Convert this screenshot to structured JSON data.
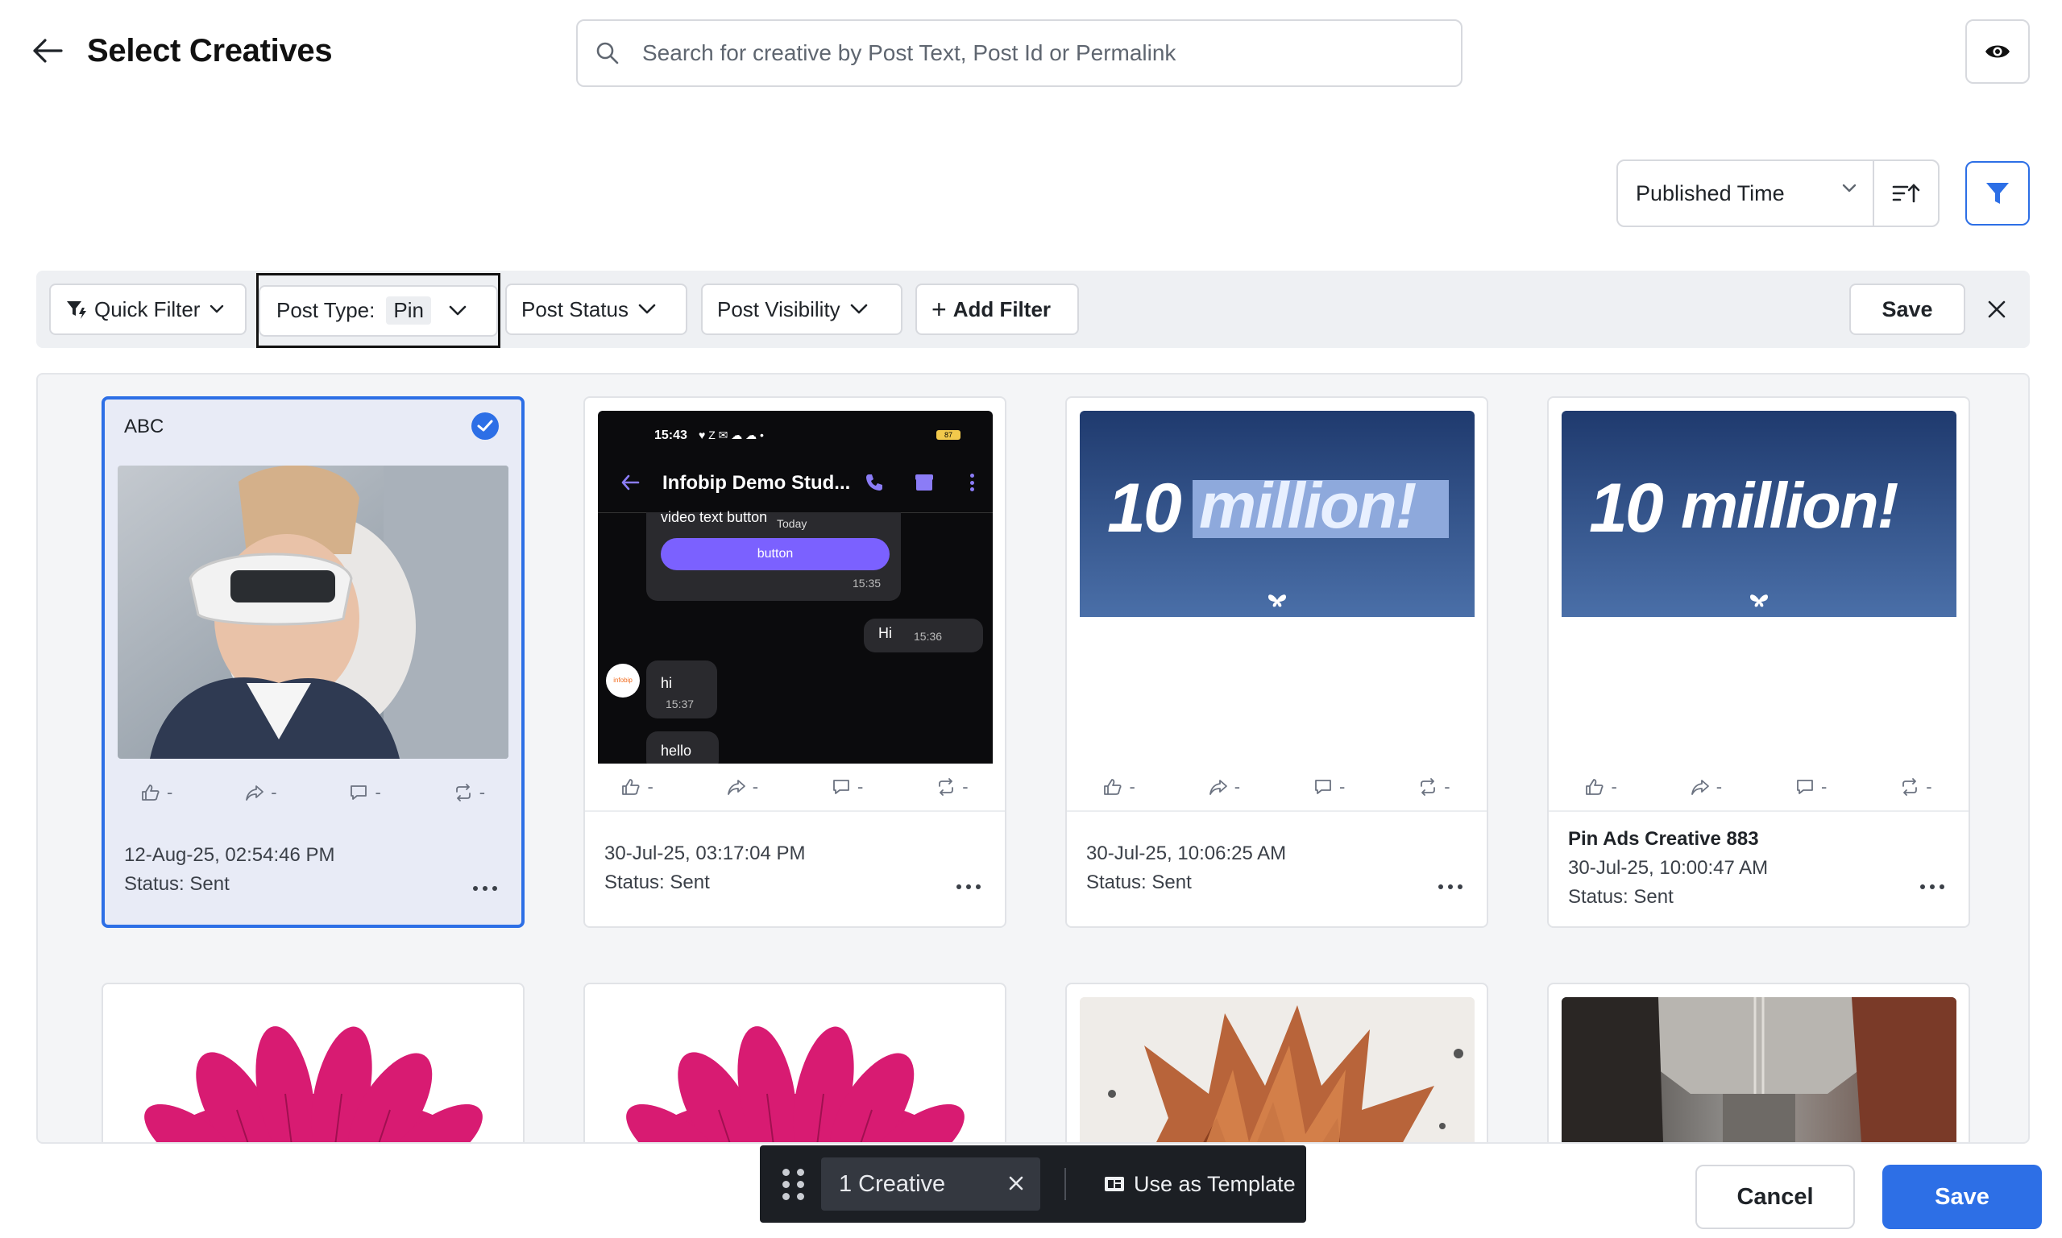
{
  "header": {
    "title": "Select Creatives",
    "search_placeholder": "Search for creative by Post Text, Post Id or Permalink"
  },
  "sort": {
    "field": "Published Time"
  },
  "filters": {
    "quick_filter": "Quick Filter",
    "post_type_label": "Post Type:",
    "post_type_value": "Pin",
    "post_status": "Post Status",
    "post_visibility": "Post Visibility",
    "add_filter": "Add Filter",
    "save": "Save"
  },
  "cards": [
    {
      "title": "ABC",
      "selected": true,
      "date": "12-Aug-25, 02:54:46 PM",
      "status": "Status: Sent",
      "likes": "-",
      "shares": "-",
      "comments": "-",
      "reposts": "-"
    },
    {
      "date": "30-Jul-25, 03:17:04 PM",
      "status": "Status: Sent",
      "likes": "-",
      "shares": "-",
      "comments": "-",
      "reposts": "-"
    },
    {
      "date": "30-Jul-25, 10:06:25 AM",
      "status": "Status: Sent",
      "likes": "-",
      "shares": "-",
      "comments": "-",
      "reposts": "-"
    },
    {
      "name": "Pin Ads Creative 883",
      "date": "30-Jul-25, 10:00:47 AM",
      "status": "Status: Sent",
      "likes": "-",
      "shares": "-",
      "comments": "-",
      "reposts": "-"
    }
  ],
  "phone_preview": {
    "time": "15:43",
    "status_icons": "♥ Z ✉ ☁ ☁ •",
    "battery": "87",
    "chat_title": "Infobip Demo Stud...",
    "msg1": "video text button",
    "today": "Today",
    "button_label": "button",
    "msg1_time": "15:35",
    "msg2": "Hi",
    "msg2_time": "15:36",
    "avatar_label": "infobip",
    "msg3": "hi",
    "msg3_time": "15:37",
    "msg4": "hello"
  },
  "banner": {
    "text_number": "10",
    "text_word": "million!"
  },
  "selection": {
    "count_label": "1 Creative",
    "template_label": "Use as Template"
  },
  "footer": {
    "cancel": "Cancel",
    "save": "Save"
  },
  "colors": {
    "accent": "#2d6fe6",
    "selected_card_bg": "#e8ebf6",
    "banner_top": "#1f3a6e",
    "banner_bottom": "#4a6fa8",
    "flower": "#d81b72"
  }
}
